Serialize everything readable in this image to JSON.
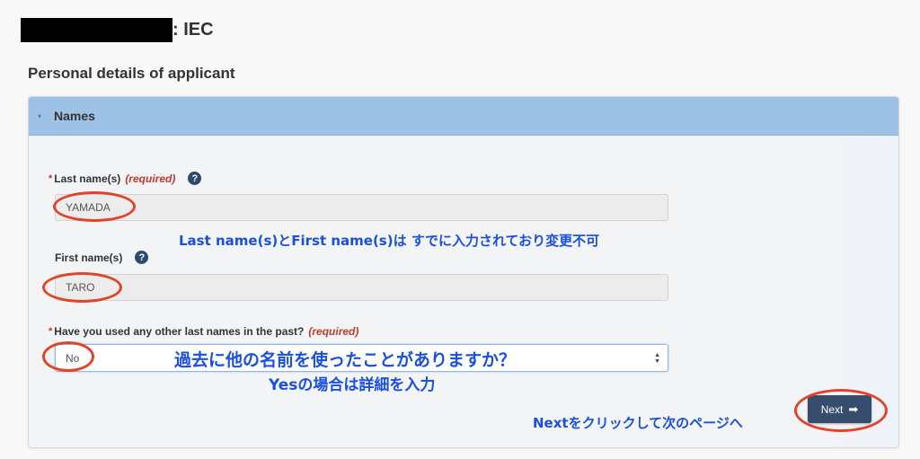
{
  "header": {
    "title_suffix": ": IEC"
  },
  "section": {
    "title": "Personal details of applicant"
  },
  "panel": {
    "title": "Names",
    "caret_icon": "▾"
  },
  "fields": {
    "last_name": {
      "required_star": "*",
      "label": "Last name(s)",
      "required_note": "(required)",
      "help_icon": "?",
      "value": "YAMADA"
    },
    "first_name": {
      "label": "First name(s)",
      "help_icon": "?",
      "value": "TARO"
    },
    "other_last_names": {
      "required_star": "*",
      "label": "Have you used any other last names in the past?",
      "required_note": "(required)",
      "selected": "No",
      "arrow_up": "▲",
      "arrow_down": "▼"
    }
  },
  "annotations": {
    "names_locked": "Last name(s)とFirst name(s)は すでに入力されており変更不可",
    "other_names_q": "過去に他の名前を使ったことがありますか？",
    "other_names_hint": "Yesの場合は詳細を入力",
    "next_hint": "Nextをクリックして次のページへ"
  },
  "actions": {
    "next_label": "Next",
    "next_arrow": "➡"
  },
  "colors": {
    "panel_header": "#9dc2e6",
    "annotation_text": "#1a4fe0",
    "highlight_ellipse": "#e0442a",
    "required": "#c0392b",
    "next_button": "#364d6e"
  }
}
